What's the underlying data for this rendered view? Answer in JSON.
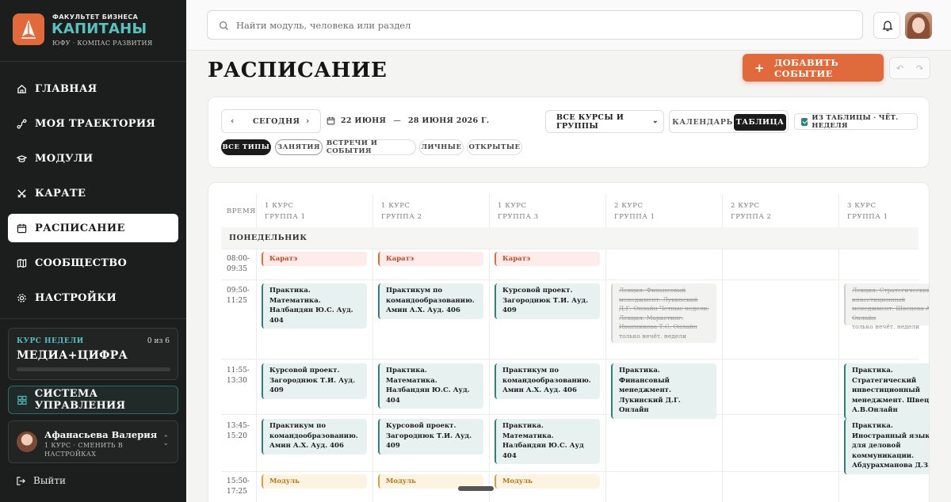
{
  "brand": {
    "small": "ФАКУЛЬТЕТ БИЗНЕСА",
    "title": "КАПИТАНЫ",
    "subtitle": "ЮФУ · КОМПАС РАЗВИТИЯ"
  },
  "nav": [
    {
      "label": "ГЛАВНАЯ",
      "icon": "home-icon"
    },
    {
      "label": "МОЯ ТРАЕКТОРИЯ",
      "icon": "trajectory-icon"
    },
    {
      "label": "МОДУЛИ",
      "icon": "graduation-cap-icon"
    },
    {
      "label": "КАРАТЕ",
      "icon": "crossed-swords-icon"
    },
    {
      "label": "РАСПИСАНИЕ",
      "icon": "calendar-icon",
      "active": true
    },
    {
      "label": "СООБЩЕСТВО",
      "icon": "map-icon"
    },
    {
      "label": "НАСТРОЙКИ",
      "icon": "gear-icon"
    }
  ],
  "course_week": {
    "label": "КУРС НЕДЕЛИ",
    "count": "0 из 6",
    "name": "МЕДИА+ЦИФРА",
    "progress": 0
  },
  "system_button": "СИСТЕМА УПРАВЛЕНИЯ",
  "user": {
    "name": "Афанасьева Валерия",
    "meta": "1 КУРС · СМЕНИТЬ В НАСТРОЙКАХ"
  },
  "logout": "Выйти",
  "search": {
    "placeholder": "Найти модуль, человека или раздел"
  },
  "page_title": "РАСПИСАНИЕ",
  "add_event": "ДОБАВИТЬ СОБЫТИЕ",
  "toolbar": {
    "today": "СЕГОДНЯ",
    "date_from": "22 ИЮНЯ",
    "date_to": "28 ИЮНЯ 2026 Г.",
    "courses_select": "ВСЕ КУРСЫ И ГРУППЫ",
    "view_calendar": "КАЛЕНДАРЬ",
    "view_table": "ТАБЛИЦА",
    "from_table": "ИЗ ТАБЛИЦЫ · ЧЁТ. НЕДЕЛЯ"
  },
  "chips": [
    "ВСЕ ТИПЫ",
    "ЗАНЯТИЯ",
    "ВСТРЕЧИ И СОБЫТИЯ",
    "ЛИЧНЫЕ",
    "ОТКРЫТЫЕ"
  ],
  "schedule": {
    "time_header": "ВРЕМЯ",
    "columns": [
      {
        "course": "1 КУРС",
        "group": "ГРУППА 1"
      },
      {
        "course": "1 КУРС",
        "group": "ГРУППА 2"
      },
      {
        "course": "1 КУРС",
        "group": "ГРУППА 3"
      },
      {
        "course": "2 КУРС",
        "group": "ГРУППА 1"
      },
      {
        "course": "2 КУРС",
        "group": "ГРУППА 2"
      },
      {
        "course": "3 КУРС",
        "group": "ГРУППА 1"
      }
    ],
    "day": "ПОНЕДЕЛЬНИК",
    "times": [
      {
        "start": "08:00-",
        "end": "09:35"
      },
      {
        "start": "09:50-",
        "end": "11:25"
      },
      {
        "start": "11:55-",
        "end": "13:30"
      },
      {
        "start": "13:45-",
        "end": "15:20"
      },
      {
        "start": "15:50-",
        "end": "17:25"
      }
    ],
    "events": {
      "karate": "Каратэ",
      "module": "Модуль",
      "r2c1": "Практика. Математика. Налбандян Ю.С. Ауд. 404",
      "r2c2": "Практикум по командообразованию. Амин А.Х. Ауд. 406",
      "r2c3": "Курсовой проект. Загороднюк Т.И. Ауд. 409",
      "r2c4_struck": "Лекция. Финансовый менеджмент. Лукинский Д.Г. Онлайн Четные недели. Лекция. Маркетинг. Иванникова Т.С. Онлайн",
      "r2c4_note": "только нечёт. недели",
      "r2c6_struck": "Лекция. Стратегический инвестиционный менеджмент. Швецова А.В. Онлайн",
      "r2c6_note": "только нечёт. недели",
      "r3c1": "Курсовой проект. Загороднюк Т.И. Ауд. 409",
      "r3c2": "Практика. Математика. Налбандян Ю.С. Ауд. 404",
      "r3c3": "Практикум по командообразованию. Амин А.Х. Ауд. 406",
      "r3c4": "Практика. Финансовый менеджмент. Лукинский Д.Г. Онлайн",
      "r3c6": "Практика. Стратегический инвестиционный менеджмент. Швецова А.В.Онлайн",
      "r4c1": "Практикум по командообразованию. Амин А.Х. Ауд. 406",
      "r4c2": "Курсовой проект. Загороднюк Т.И. Ауд. 409",
      "r4c3": "Практика. Математика. Налбандян Ю.С. Ауд 404",
      "r4c6": "Практика. Иностранный язык для деловой коммуникации. Абдурахманова Д.З."
    }
  },
  "colors": {
    "accent": "#e06a3c",
    "teal": "#58c2c0",
    "sidebar_bg": "#1c1d1d"
  }
}
